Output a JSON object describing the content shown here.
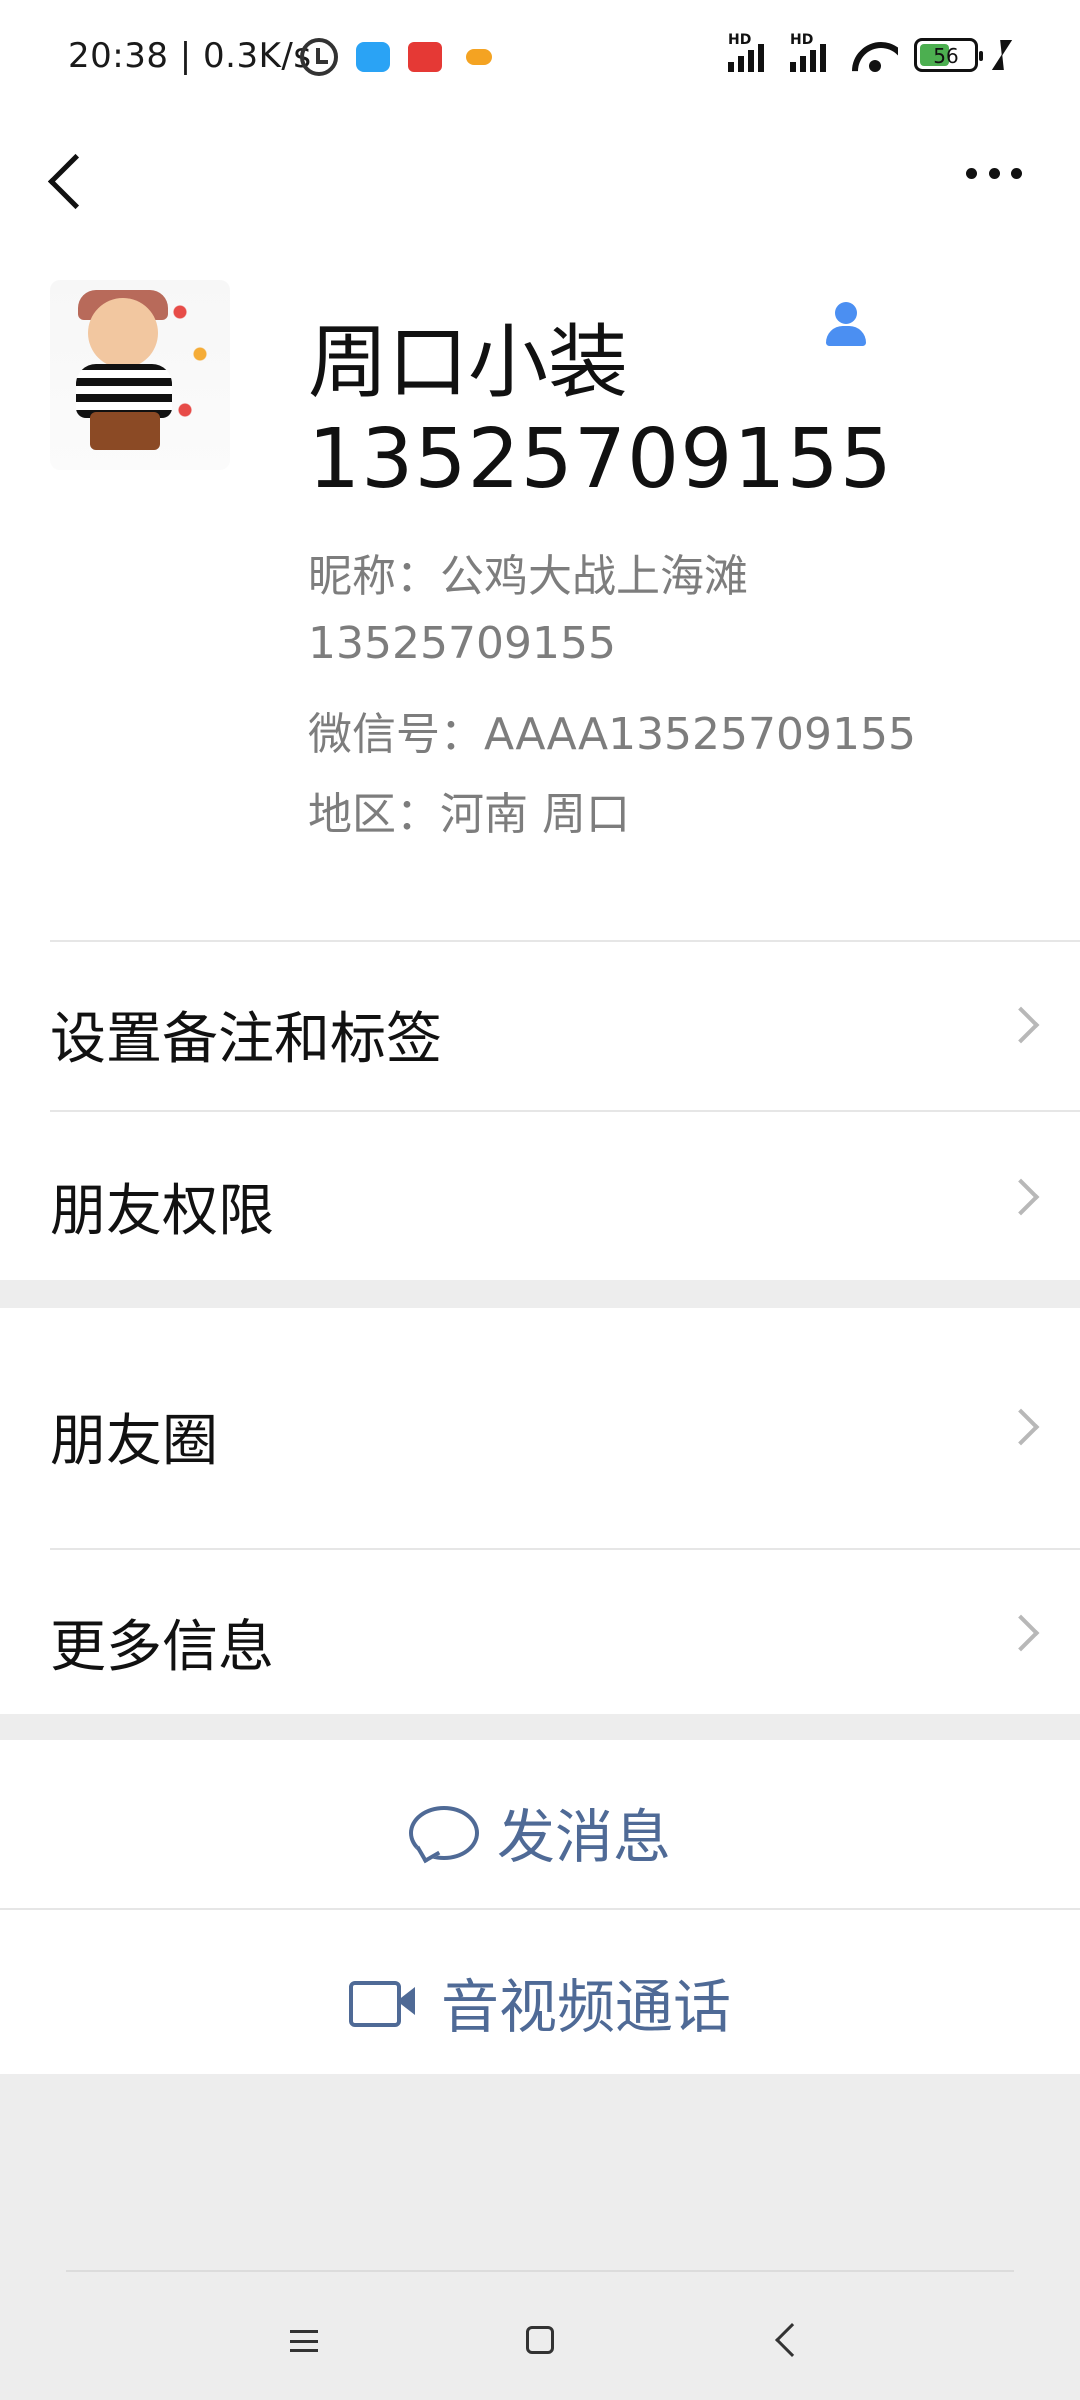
{
  "status_bar": {
    "time_and_speed": "20:38 | 0.3K/s",
    "battery_level": "56",
    "battery_fraction": 0.56,
    "icons": [
      "alarm-icon",
      "cloud-app-icon",
      "news-app-icon",
      "game-app-icon",
      "hd-signal-icon",
      "hd-signal-icon",
      "wifi-icon",
      "battery-icon",
      "charging-icon"
    ],
    "hd_label": "HD"
  },
  "nav": {
    "back_icon": "back-icon",
    "more_icon": "more-icon"
  },
  "profile": {
    "name": "周口小装",
    "phone_big": "13525709155",
    "nickname_line": "昵称：公鸡大战上海滩",
    "phone_line": "13525709155",
    "wxid_line": "微信号：AAAA13525709155",
    "region_line": "地区：河南  周口",
    "contact_icon": "contact-icon",
    "contact_icon_color": "#4b8ff2"
  },
  "menu_group1": [
    {
      "label": "设置备注和标签"
    },
    {
      "label": "朋友权限"
    }
  ],
  "menu_group2": [
    {
      "label": "朋友圈"
    },
    {
      "label": "更多信息"
    }
  ],
  "actions": {
    "send_message": "发消息",
    "voice_video_call": "音视频通话",
    "accent_color": "#4f6a96"
  },
  "bottom_nav": {
    "menu_icon": "menu-icon",
    "home_icon": "home-icon",
    "back_icon": "back-icon"
  }
}
